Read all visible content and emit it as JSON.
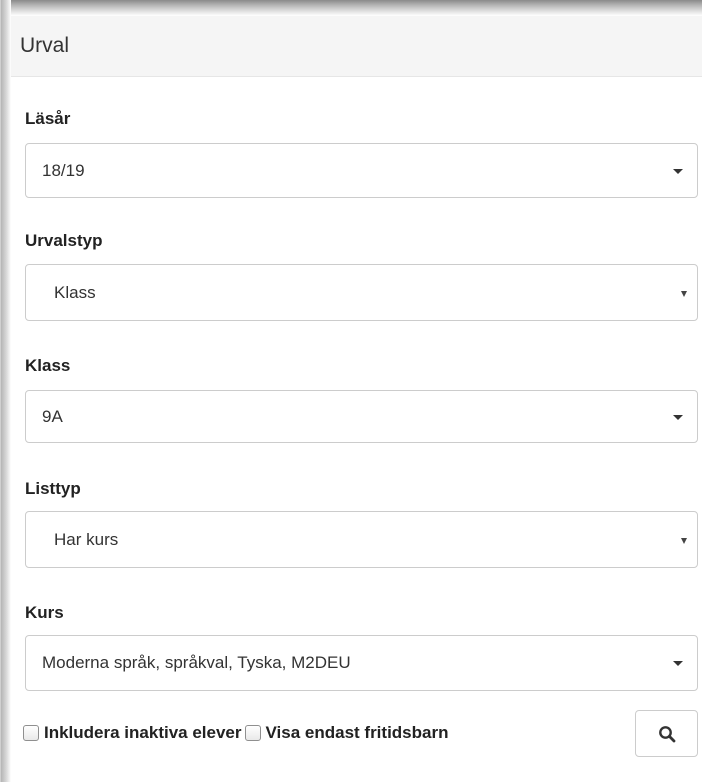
{
  "panel": {
    "title": "Urval"
  },
  "fields": {
    "lasar": {
      "label": "Läsår",
      "value": "18/19"
    },
    "urvalstyp": {
      "label": "Urvalstyp",
      "value": "Klass"
    },
    "klass": {
      "label": "Klass",
      "value": "9A"
    },
    "listtyp": {
      "label": "Listtyp",
      "value": "Har kurs"
    },
    "kurs": {
      "label": "Kurs",
      "value": "Moderna språk, språkval, Tyska, M2DEU"
    }
  },
  "options": {
    "include_inactive": {
      "label": "Inkludera inaktiva elever",
      "checked": false
    },
    "only_afterschool": {
      "label": "Visa endast fritidsbarn",
      "checked": false
    }
  },
  "icons": {
    "search": "search-icon"
  },
  "colors": {
    "heading_bg": "#f5f5f5",
    "border": "#cccccc",
    "text": "#333333"
  }
}
